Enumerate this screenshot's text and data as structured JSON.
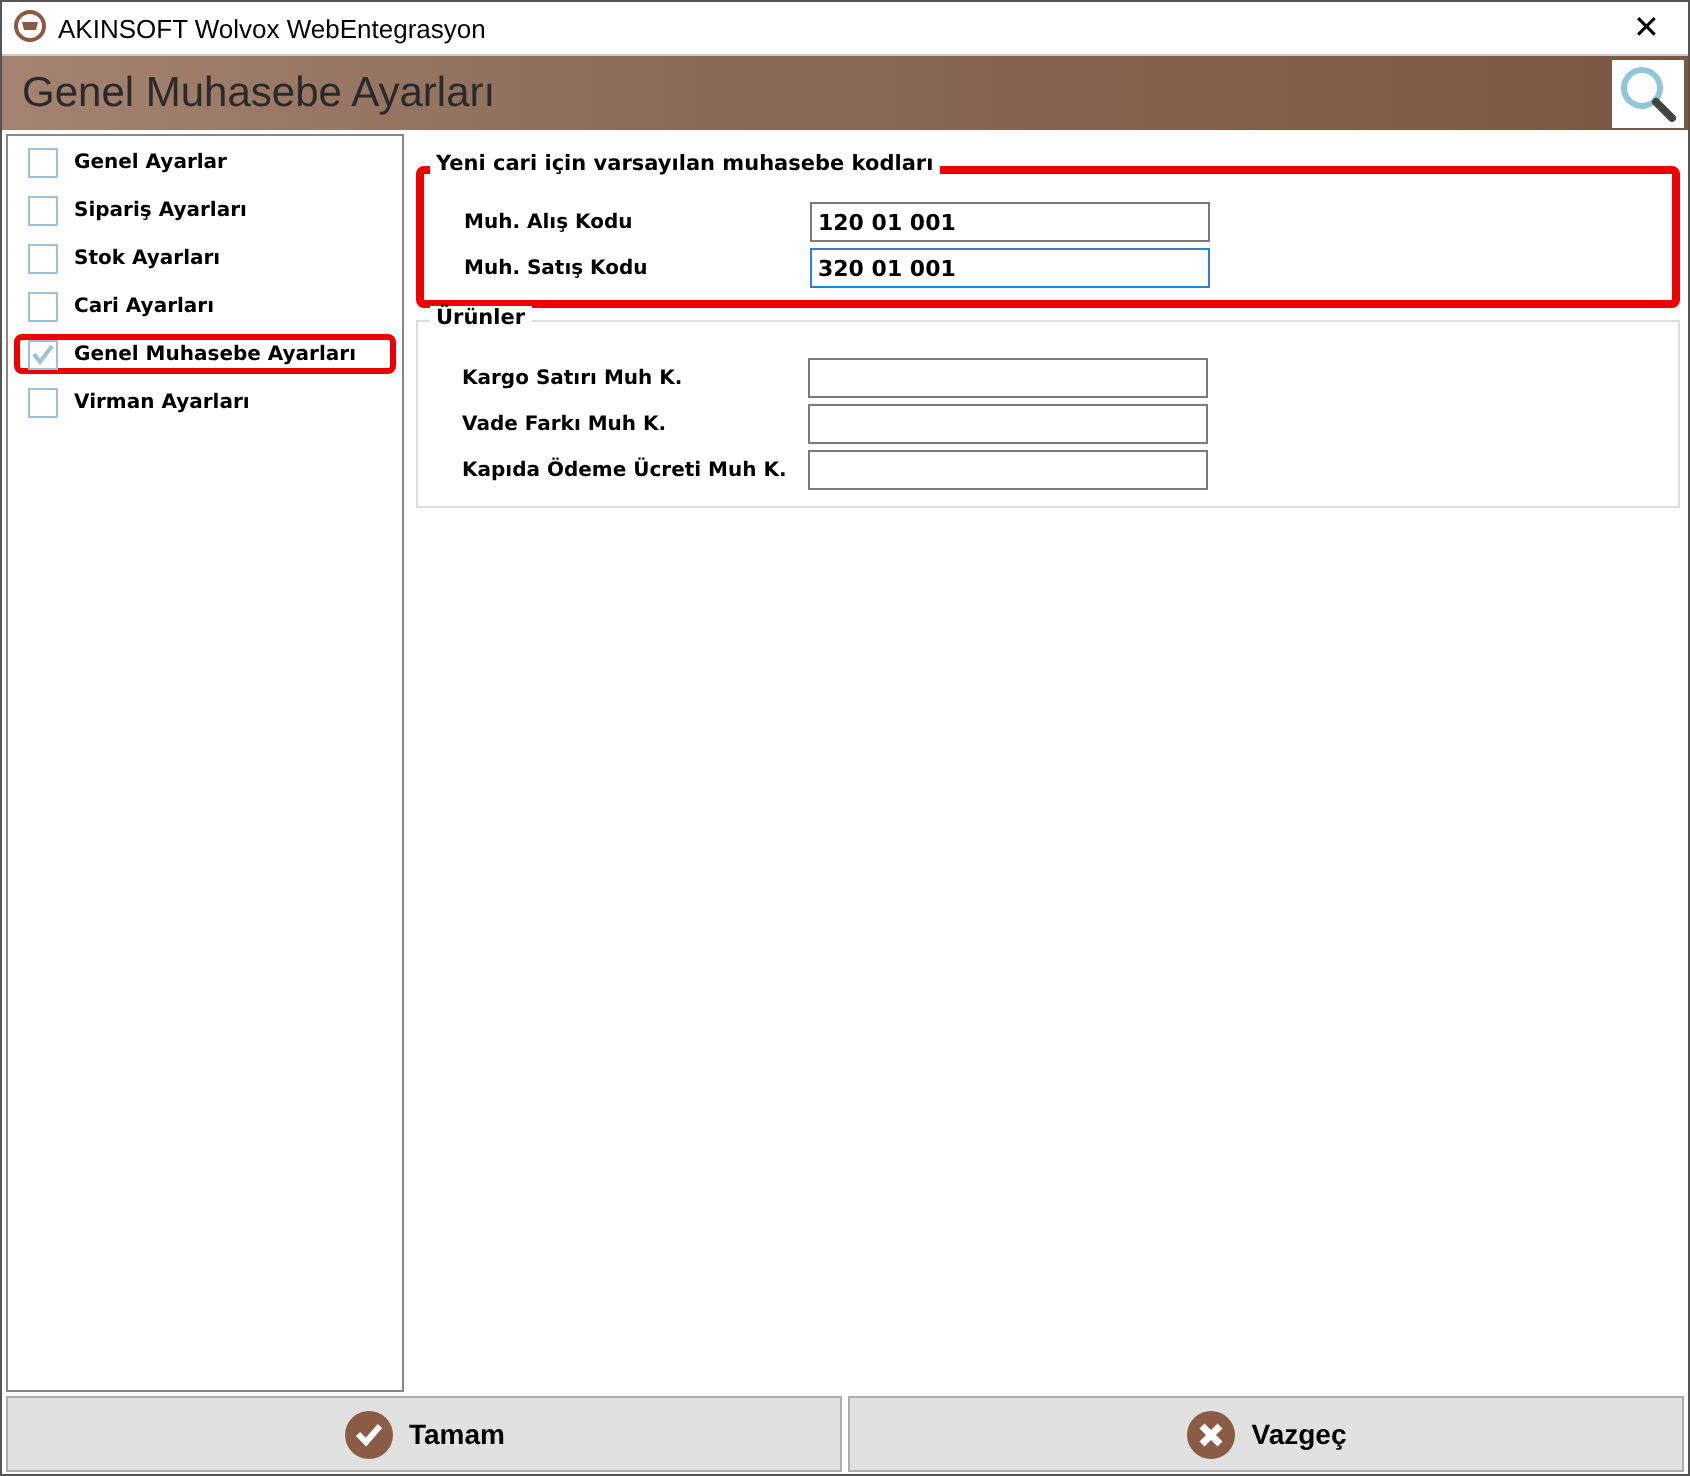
{
  "window": {
    "title": "AKINSOFT Wolvox WebEntegrasyon",
    "close": "✕"
  },
  "header": {
    "title": "Genel Muhasebe Ayarları"
  },
  "sidebar": {
    "items": [
      {
        "label": "Genel Ayarlar",
        "checked": false,
        "highlighted": false
      },
      {
        "label": "Sipariş Ayarları",
        "checked": false,
        "highlighted": false
      },
      {
        "label": "Stok Ayarları",
        "checked": false,
        "highlighted": false
      },
      {
        "label": "Cari Ayarları",
        "checked": false,
        "highlighted": false
      },
      {
        "label": "Genel Muhasebe Ayarları",
        "checked": true,
        "highlighted": true
      },
      {
        "label": "Virman Ayarları",
        "checked": false,
        "highlighted": false
      }
    ]
  },
  "groups": [
    {
      "title": "Yeni cari için varsayılan muhasebe kodları",
      "highlighted": true,
      "fields": [
        {
          "label": "Muh. Alış Kodu",
          "value": "120 01 001",
          "focused": false
        },
        {
          "label": "Muh. Satış Kodu",
          "value": "320 01 001",
          "focused": true
        }
      ]
    },
    {
      "title": "Ürünler",
      "highlighted": false,
      "fields": [
        {
          "label": "Kargo Satırı Muh K.",
          "focused": false
        },
        {
          "label": "Vade Farkı Muh K.",
          "focused": false
        },
        {
          "label": "Kapıda Ödeme Ücreti Muh K.",
          "focused": false
        }
      ]
    }
  ],
  "buttons": [
    {
      "label": "Tamam",
      "kind": "ok"
    },
    {
      "label": "Vazgeç",
      "kind": "cancel"
    }
  ]
}
